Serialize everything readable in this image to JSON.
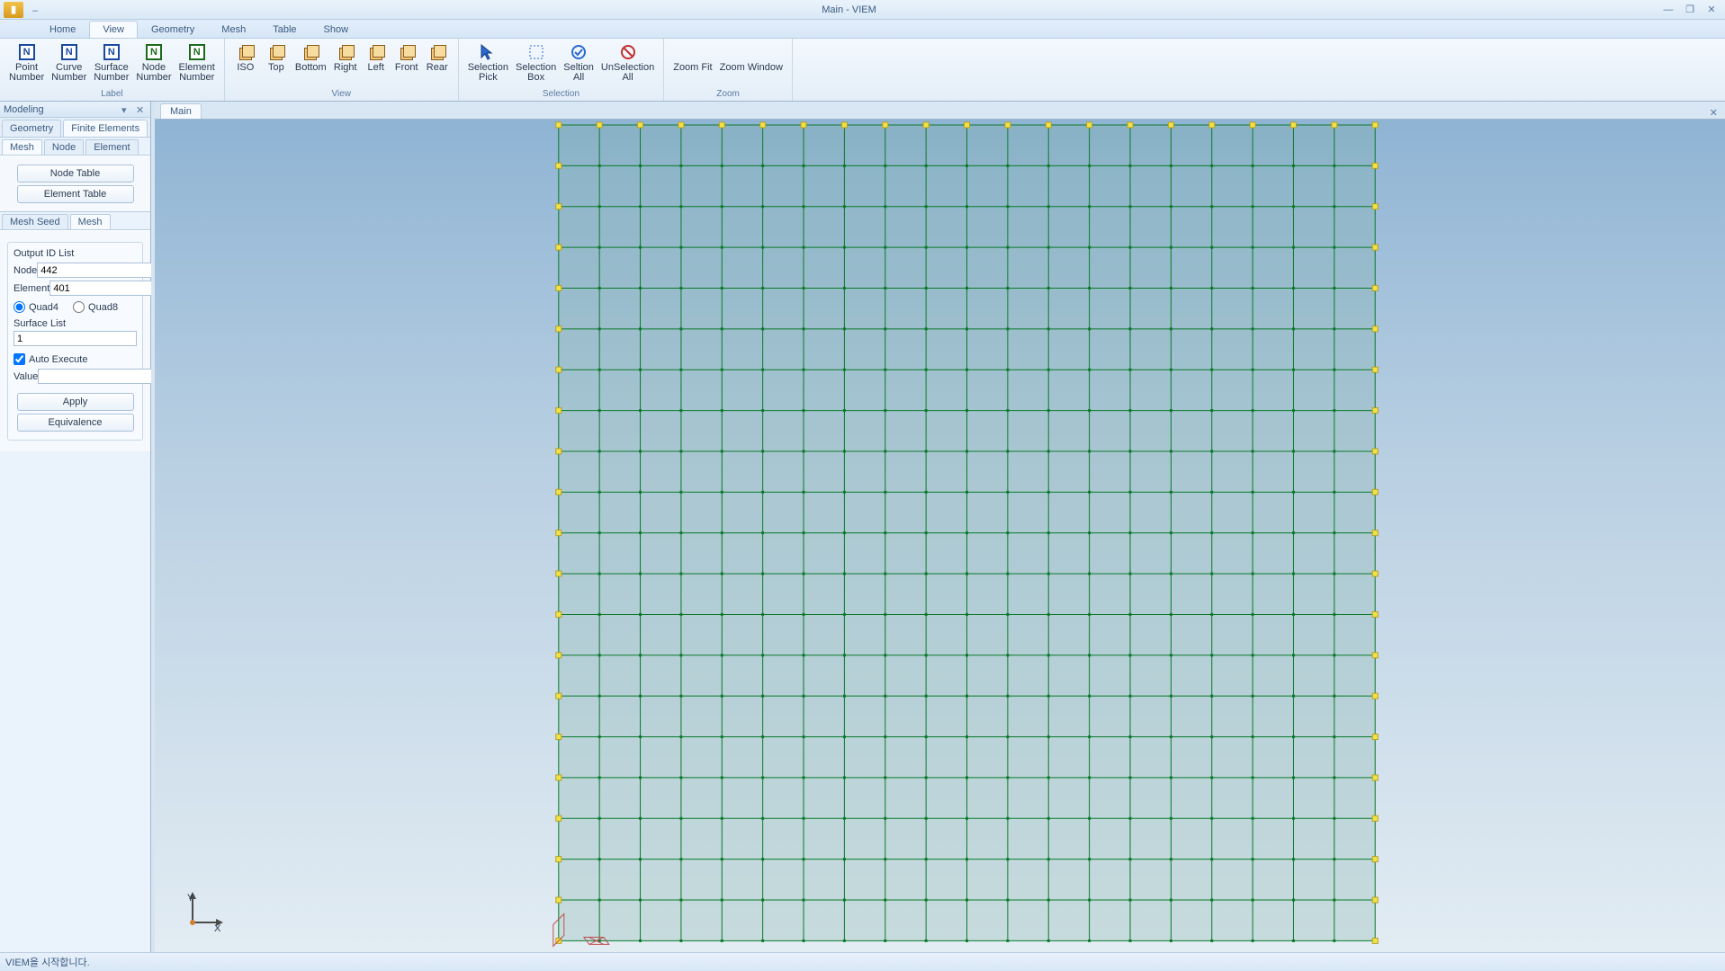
{
  "app": {
    "title": "Main - VIEM",
    "qat_dash": "–"
  },
  "win_controls": {
    "min": "—",
    "max": "❐",
    "close": "✕"
  },
  "tabs": {
    "home": "Home",
    "view": "View",
    "geometry": "Geometry",
    "mesh": "Mesh",
    "table": "Table",
    "show": "Show"
  },
  "ribbon": {
    "label_group": "Label",
    "view_group": "View",
    "selection_group": "Selection",
    "zoom_group": "Zoom",
    "point_number": "Point",
    "point_number2": "Number",
    "curve_number": "Curve",
    "curve_number2": "Number",
    "surface_number": "Surface",
    "surface_number2": "Number",
    "node_number": "Node",
    "node_number2": "Number",
    "element_number": "Element",
    "element_number2": "Number",
    "iso": "ISO",
    "top": "Top",
    "bottom": "Bottom",
    "right": "Right",
    "left": "Left",
    "front": "Front",
    "rear": "Rear",
    "sel_pick": "Selection",
    "sel_pick2": "Pick",
    "sel_box": "Selection",
    "sel_box2": "Box",
    "sel_all": "Seltion",
    "sel_all2": "All",
    "unsel_all": "UnSelection",
    "unsel_all2": "All",
    "zoom_fit": "Zoom Fit",
    "zoom_window": "Zoom Window"
  },
  "panel": {
    "title": "Modeling",
    "tab_geometry": "Geometry",
    "tab_fe": "Finite Elements",
    "itab_mesh": "Mesh",
    "itab_node": "Node",
    "itab_element": "Element",
    "btn_node_table": "Node Table",
    "btn_element_table": "Element Table",
    "subtab_seed": "Mesh Seed",
    "subtab_mesh": "Mesh",
    "output_id_list": "Output ID List",
    "node_label": "Node",
    "node_value": "442",
    "element_label": "Element",
    "element_value": "401",
    "quad4": "Quad4",
    "quad8": "Quad8",
    "surface_list": "Surface List",
    "surface_value": "1",
    "auto_execute": "Auto Execute",
    "value_label": "Value",
    "value_value": "",
    "apply": "Apply",
    "equivalence": "Equivalence"
  },
  "view": {
    "tab_main": "Main",
    "axis_x": "X",
    "axis_y": "Y"
  },
  "status": {
    "text": "VIEM을 시작합니다."
  },
  "mesh": {
    "cols": 20,
    "rows": 20
  }
}
